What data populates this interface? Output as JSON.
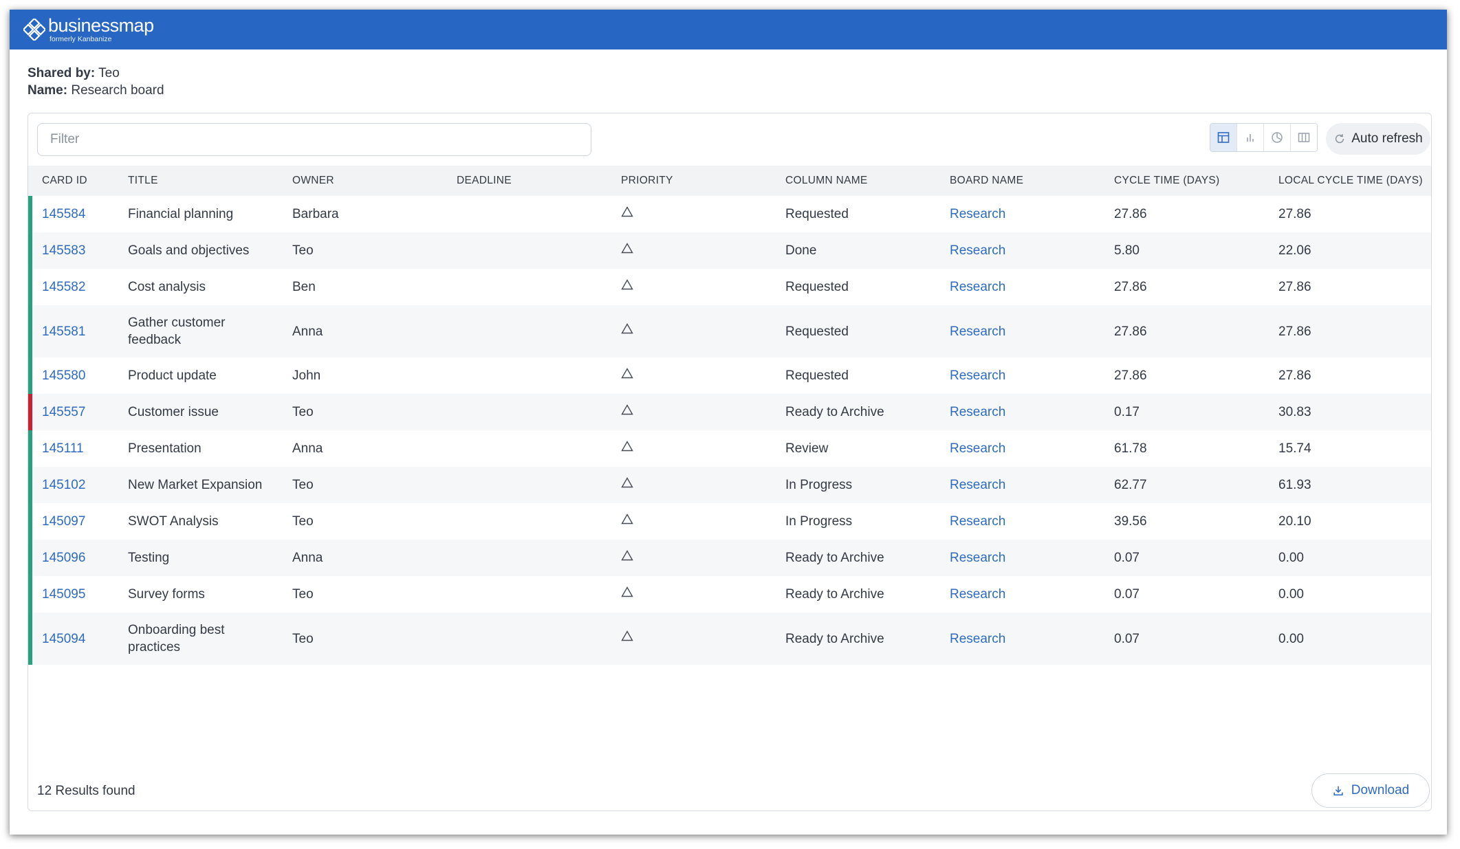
{
  "brand": {
    "name": "businessmap",
    "subtitle": "formerly Kanbanize"
  },
  "share": {
    "shared_by_label": "Shared by:",
    "shared_by": "Teo",
    "name_label": "Name:",
    "name": "Research board"
  },
  "filter": {
    "placeholder": "Filter",
    "value": ""
  },
  "toolbar": {
    "view_buttons": [
      "table-view-icon",
      "bar-chart-icon",
      "pie-chart-icon",
      "columns-icon"
    ],
    "active_view": "table-view-icon",
    "auto_refresh_label": "Auto refresh"
  },
  "table": {
    "columns": [
      "CARD ID",
      "TITLE",
      "OWNER",
      "DEADLINE",
      "PRIORITY",
      "COLUMN NAME",
      "BOARD NAME",
      "CYCLE TIME (DAYS)",
      "LOCAL CYCLE TIME (DAYS)"
    ],
    "rows": [
      {
        "id": "145584",
        "title": "Financial planning",
        "owner": "Barbara",
        "deadline": "",
        "priority": "triangle-icon",
        "column": "Requested",
        "board": "Research",
        "cycle": "27.86",
        "local_cycle": "27.86",
        "bar_color": "#27a17e"
      },
      {
        "id": "145583",
        "title": "Goals and objectives",
        "owner": "Teo",
        "deadline": "",
        "priority": "triangle-icon",
        "column": "Done",
        "board": "Research",
        "cycle": "5.80",
        "local_cycle": "22.06",
        "bar_color": "#27a17e"
      },
      {
        "id": "145582",
        "title": "Cost analysis",
        "owner": "Ben",
        "deadline": "",
        "priority": "triangle-icon",
        "column": "Requested",
        "board": "Research",
        "cycle": "27.86",
        "local_cycle": "27.86",
        "bar_color": "#27a17e"
      },
      {
        "id": "145581",
        "title": "Gather customer feedback",
        "owner": "Anna",
        "deadline": "",
        "priority": "triangle-icon",
        "column": "Requested",
        "board": "Research",
        "cycle": "27.86",
        "local_cycle": "27.86",
        "bar_color": "#27a17e"
      },
      {
        "id": "145580",
        "title": "Product update",
        "owner": "John",
        "deadline": "",
        "priority": "triangle-icon",
        "column": "Requested",
        "board": "Research",
        "cycle": "27.86",
        "local_cycle": "27.86",
        "bar_color": "#27a17e"
      },
      {
        "id": "145557",
        "title": "Customer issue",
        "owner": "Teo",
        "deadline": "",
        "priority": "triangle-icon",
        "column": "Ready to Archive",
        "board": "Research",
        "cycle": "0.17",
        "local_cycle": "30.83",
        "bar_color": "#cf1f32"
      },
      {
        "id": "145111",
        "title": "Presentation",
        "owner": "Anna",
        "deadline": "",
        "priority": "triangle-icon",
        "column": "Review",
        "board": "Research",
        "cycle": "61.78",
        "local_cycle": "15.74",
        "bar_color": "#27a17e"
      },
      {
        "id": "145102",
        "title": "New Market Expansion",
        "owner": "Teo",
        "deadline": "",
        "priority": "triangle-icon",
        "column": "In Progress",
        "board": "Research",
        "cycle": "62.77",
        "local_cycle": "61.93",
        "bar_color": "#27a17e"
      },
      {
        "id": "145097",
        "title": "SWOT Analysis",
        "owner": "Teo",
        "deadline": "",
        "priority": "triangle-icon",
        "column": "In Progress",
        "board": "Research",
        "cycle": "39.56",
        "local_cycle": "20.10",
        "bar_color": "#27a17e"
      },
      {
        "id": "145096",
        "title": "Testing",
        "owner": "Anna",
        "deadline": "",
        "priority": "triangle-icon",
        "column": "Ready to Archive",
        "board": "Research",
        "cycle": "0.07",
        "local_cycle": "0.00",
        "bar_color": "#27a17e"
      },
      {
        "id": "145095",
        "title": "Survey forms",
        "owner": "Teo",
        "deadline": "",
        "priority": "triangle-icon",
        "column": "Ready to Archive",
        "board": "Research",
        "cycle": "0.07",
        "local_cycle": "0.00",
        "bar_color": "#27a17e"
      },
      {
        "id": "145094",
        "title": "Onboarding best practices",
        "owner": "Teo",
        "deadline": "",
        "priority": "triangle-icon",
        "column": "Ready to Archive",
        "board": "Research",
        "cycle": "0.07",
        "local_cycle": "0.00",
        "bar_color": "#27a17e"
      }
    ]
  },
  "footer": {
    "results_text": "12 Results found",
    "download_label": "Download"
  }
}
